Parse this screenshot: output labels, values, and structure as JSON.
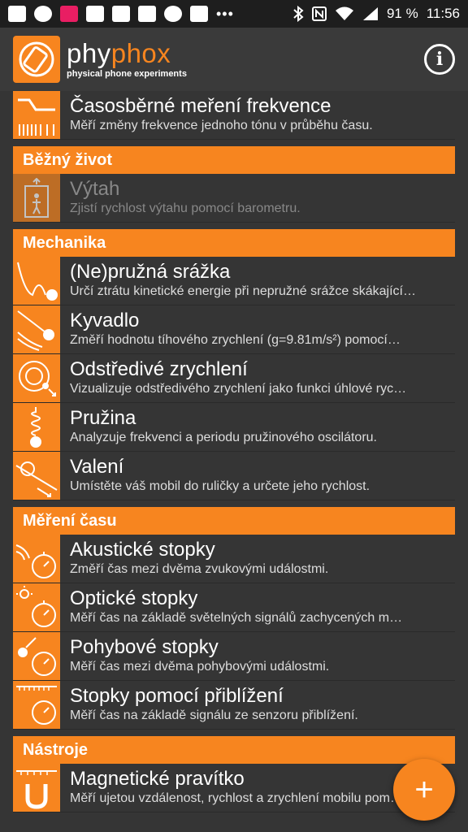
{
  "status_bar": {
    "battery": "91 %",
    "time": "11:56"
  },
  "app": {
    "title_part1": "phy",
    "title_part2": "phox",
    "subtitle": "physical phone experiments",
    "accent": "#f7851f"
  },
  "top_item": {
    "title": "Časosběrné meření frekvence",
    "desc": "Měří změny frekvence jednoho tónu v průběhu času."
  },
  "categories": [
    {
      "name": "Běžný život",
      "items": [
        {
          "title": "Výtah",
          "desc": "Zjistí rychlost výtahu pomocí barometru.",
          "icon": "elevator-icon",
          "disabled": true
        }
      ]
    },
    {
      "name": "Mechanika",
      "items": [
        {
          "title": "(Ne)pružná srážka",
          "desc": "Určí ztrátu kinetické energie při nepružné srážce skákající…",
          "icon": "bounce-icon"
        },
        {
          "title": "Kyvadlo",
          "desc": "Změří hodnotu tíhového zrychlení (g=9.81m/s²) pomocí…",
          "icon": "pendulum-icon"
        },
        {
          "title": "Odstředivé zrychlení",
          "desc": "Vizualizuje odstředivého zrychlení jako funkci úhlové ryc…",
          "icon": "centrifugal-icon"
        },
        {
          "title": "Pružina",
          "desc": "Analyzuje frekvenci a periodu pružinového oscilátoru.",
          "icon": "spring-icon"
        },
        {
          "title": "Valení",
          "desc": "Umístěte váš mobil do ruličky a určete jeho rychlost.",
          "icon": "roll-icon"
        }
      ]
    },
    {
      "name": "Měření času",
      "items": [
        {
          "title": "Akustické stopky",
          "desc": "Změří čas mezi dvěma zvukovými událostmi.",
          "icon": "acoustic-stopwatch-icon"
        },
        {
          "title": "Optické stopky",
          "desc": "Měří čas na základě světelných signálů zachycených m…",
          "icon": "optical-stopwatch-icon"
        },
        {
          "title": "Pohybové stopky",
          "desc": "Měří čas mezi dvěma pohybovými událostmi.",
          "icon": "motion-stopwatch-icon"
        },
        {
          "title": "Stopky pomocí přiblížení",
          "desc": "Měří čas na základě signálu ze senzoru přiblížení.",
          "icon": "proximity-stopwatch-icon"
        }
      ]
    },
    {
      "name": "Nástroje",
      "items": [
        {
          "title": "Magnetické pravítko",
          "desc": "Měří ujetou vzdálenost, rychlost a zrychlení mobilu pom…",
          "icon": "magnet-icon"
        }
      ]
    }
  ],
  "fab": {
    "label": "+"
  }
}
